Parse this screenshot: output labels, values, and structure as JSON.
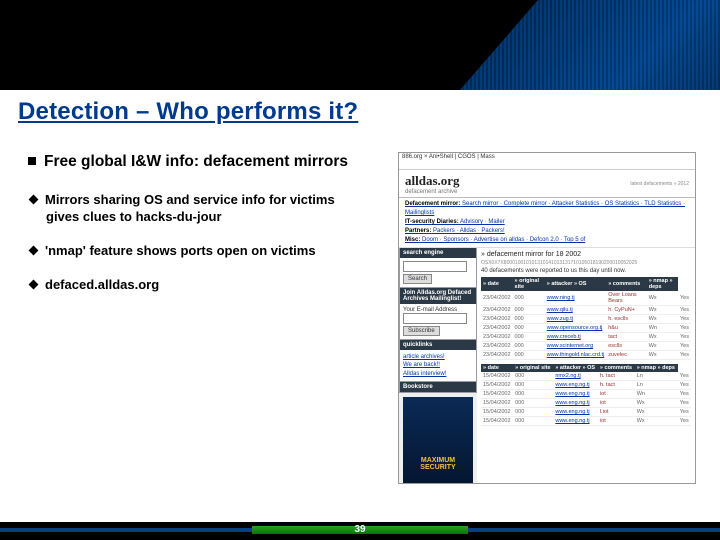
{
  "title": "Detection – Who performs it?",
  "heading": "Free global I&W info: defacement mirrors",
  "bullets": [
    "Mirrors sharing OS and service info for victims gives clues to hacks-du-jour",
    "'nmap' feature shows ports open on victims",
    "defaced.alldas.org"
  ],
  "page_number": "39",
  "shot": {
    "tabs": "886.org × Ani•Shell | CGOS | Mass",
    "logo": "alldas.org",
    "tagline": "defacement archive",
    "linkrow1_label": "Defacement mirror:",
    "linkrow1": "Search mirror · Complete mirror · Attacker Statistics · OS Statistics · TLD Statistics · Mailinglists",
    "linkrow2_label": "IT-security Diaries:",
    "linkrow2": "Advisory · Mailer",
    "linkrow3_label": "Partners:",
    "linkrow3": "Packers · Alldas · Packers!",
    "linkrow4_label": "Misc:",
    "linkrow4": "Doom · Sponsors · Advertise on alldas · Defcon 2.0 · Top 5 of",
    "side": {
      "search_h": "search engine",
      "search_btn": "Search",
      "join_h": "Join Alldas.org Defaced Archives Mailinglist!",
      "join_label": "Your E-mail Address",
      "join_btn": "Subscribe",
      "quick_h": "quicklinks",
      "q1": "article archives!",
      "q2": "We are back!!",
      "q3": "Alldas interview!",
      "ad_h": "Bookstore",
      "ad_title": "MAXIMUM SECURITY"
    },
    "main": {
      "title": "» defacement mirror for 18 2002",
      "count_line": "OSX0X7X800010010101310141013131710105018190200010052025",
      "note": "40 defacements were reported to us this day until now.",
      "headers": [
        "» date",
        "» original site",
        "» attacker » OS",
        "» comments",
        "» nmap  » deps"
      ],
      "rows": [
        [
          "23/04/2002",
          "000",
          "www.ning.tj",
          "Over Loans Bears",
          "Wx",
          "Yes"
        ],
        [
          "23/04/2002",
          "000",
          "www.qilu.tj",
          "h. CyPuN+",
          "Wx",
          "Yes"
        ],
        [
          "23/04/2002",
          "000",
          "www.zug.tj",
          "h. esclls",
          "Wx",
          "Yes"
        ],
        [
          "23/04/2002",
          "000",
          "www.opensource.org.tj",
          "h&u",
          "Wn",
          "Yes"
        ],
        [
          "23/04/2002",
          "000",
          "www.creceb.tj",
          "tact",
          "Wx",
          "Yes"
        ],
        [
          "23/04/2002",
          "000",
          "www.scinternet.org",
          "esclls",
          "Wx",
          "Yes"
        ],
        [
          "23/04/2002",
          "000",
          "www.thingold.nlac.crd.tj",
          "zuvelec",
          "Wx",
          "Yes"
        ]
      ],
      "rows2": [
        [
          "15/04/2002",
          "000",
          "nmx2.ng.tj",
          "h. tact",
          "Ln",
          "Yes"
        ],
        [
          "15/04/2002",
          "000",
          "www.eng.ng.tj",
          "h. tact",
          "Ln",
          "Yes"
        ],
        [
          "15/04/2002",
          "000",
          "www.eng.ng.tj",
          "iot",
          "Wn",
          "Yes"
        ],
        [
          "15/04/2002",
          "000",
          "www.eng.ng.tj",
          "iot",
          "Wx",
          "Yes"
        ],
        [
          "15/04/2002",
          "000",
          "www.eng.ng.tj",
          "l.iot",
          "Wx",
          "Yes"
        ],
        [
          "15/04/2002",
          "000",
          "www.eng.ng.tj",
          "iot",
          "Wx",
          "Yes"
        ]
      ]
    }
  }
}
